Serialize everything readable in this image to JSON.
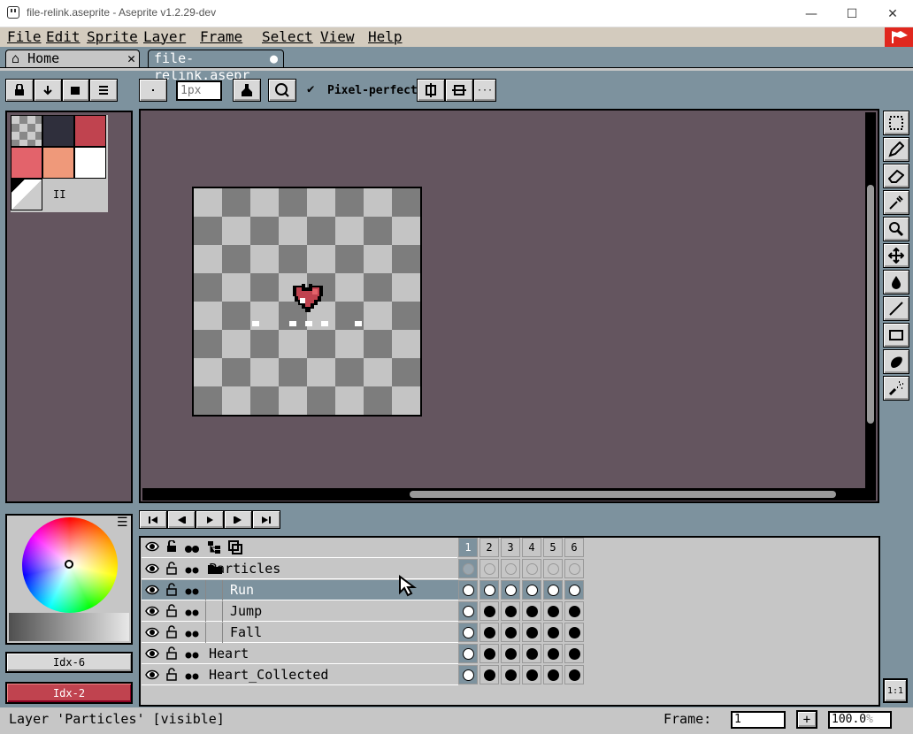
{
  "window": {
    "title": "file-relink.aseprite - Aseprite v1.2.29-dev",
    "minimize": "—",
    "maximize": "☐",
    "close": "✕"
  },
  "menu": [
    "File",
    "Edit",
    "Sprite",
    "Layer",
    "Frame",
    "Select",
    "View",
    "Help"
  ],
  "tabs": [
    {
      "label": "Home",
      "close": "✕"
    },
    {
      "label": "file-relink.asepr",
      "modified": "●"
    }
  ],
  "toolbar": {
    "brush_size_placeholder": "1px",
    "pixel_perfect_label": "Pixel-perfect",
    "more": "···"
  },
  "palette": {
    "colors": [
      "checker",
      "#2f2f3c",
      "#c0434f",
      "#e3636b",
      "#ef997a",
      "#ffffff"
    ],
    "pause_glyph": "II"
  },
  "color_wheel": {
    "menu_icon": "☰"
  },
  "swatches": {
    "fg_label": "Idx-6",
    "bg_label": "Idx-2",
    "bg_color": "#c0434f"
  },
  "timeline": {
    "frames": [
      "1",
      "2",
      "3",
      "4",
      "5",
      "6"
    ],
    "layers": [
      {
        "name": "Particles",
        "indent": 0,
        "group": true,
        "selected": false
      },
      {
        "name": "Run",
        "indent": 1,
        "group": false,
        "selected": true
      },
      {
        "name": "Jump",
        "indent": 1,
        "group": false,
        "selected": false
      },
      {
        "name": "Fall",
        "indent": 1,
        "group": false,
        "selected": false
      },
      {
        "name": "Heart",
        "indent": 0,
        "group": false,
        "selected": false
      },
      {
        "name": "Heart_Collected",
        "indent": 0,
        "group": false,
        "selected": false
      }
    ]
  },
  "status": {
    "message": "Layer 'Particles' [visible]",
    "frame_label": "Frame:",
    "frame_value": "1",
    "add_frame": "+",
    "zoom_value": "100.0",
    "zoom_unit": "%",
    "ratio_button": "1:1"
  },
  "colors": {
    "background": "#7d929e",
    "canvas": "#64555f",
    "selected_layer": "#7d929e",
    "accent_red": "#c0434f"
  }
}
